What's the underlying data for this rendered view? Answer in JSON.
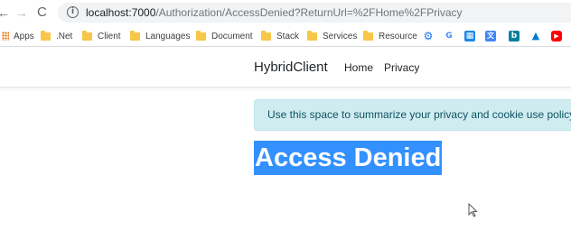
{
  "browser": {
    "url_host": "localhost:7000",
    "url_path": "/Authorization/AccessDenied?ReturnUrl=%2FHome%2FPrivacy",
    "bookmarks": [
      {
        "label": "Apps"
      },
      {
        "label": ".Net"
      },
      {
        "label": "Client"
      },
      {
        "label": "Languages"
      },
      {
        "label": "Document"
      },
      {
        "label": "Stack"
      },
      {
        "label": "Services"
      },
      {
        "label": "Resource"
      }
    ],
    "extension_icons": [
      "settings-gear-icon",
      "google-icon",
      "extension-icon",
      "translate-icon",
      "bing-icon",
      "azure-icon",
      "youtube-icon"
    ]
  },
  "site": {
    "brand": "HybridClient",
    "nav": {
      "home": "Home",
      "privacy": "Privacy"
    },
    "cookie_message": "Use this space to summarize your privacy and cookie use policy.",
    "heading": "Access Denied"
  },
  "colors": {
    "cookie_bg": "#d1ecf1",
    "cookie_text": "#0c5460",
    "selection_bg": "#3390ff"
  }
}
